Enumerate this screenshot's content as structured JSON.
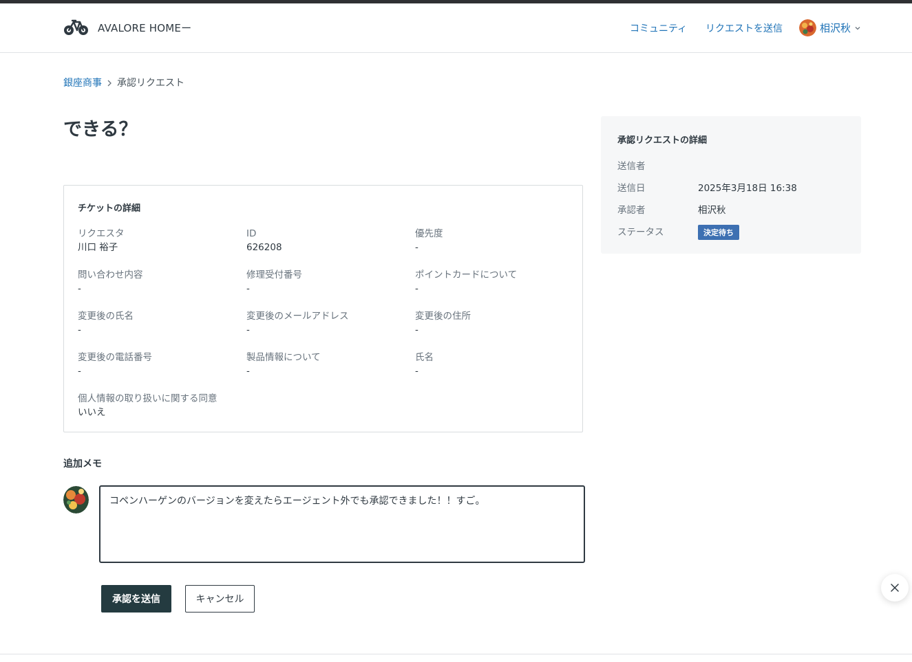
{
  "header": {
    "brand": "AVALORE HOMEー",
    "nav": {
      "community": "コミュニティ",
      "submit_request": "リクエストを送信"
    },
    "user": {
      "name": "相沢秋"
    }
  },
  "breadcrumb": {
    "parent": "銀座商事",
    "current": "承認リクエスト"
  },
  "page_title": "できる？",
  "ticket": {
    "heading": "チケットの詳細",
    "fields": [
      {
        "label": "リクエスタ",
        "value": "川口 裕子"
      },
      {
        "label": "ID",
        "value": "626208"
      },
      {
        "label": "優先度",
        "value": "-"
      },
      {
        "label": "問い合わせ内容",
        "value": "-"
      },
      {
        "label": "修理受付番号",
        "value": "-"
      },
      {
        "label": "ポイントカードについて",
        "value": "-"
      },
      {
        "label": "変更後の氏名",
        "value": "-"
      },
      {
        "label": "変更後のメールアドレス",
        "value": "-"
      },
      {
        "label": "変更後の住所",
        "value": "-"
      },
      {
        "label": "変更後の電話番号",
        "value": "-"
      },
      {
        "label": "製品情報について",
        "value": "-"
      },
      {
        "label": "氏名",
        "value": "-"
      },
      {
        "label": "個人情報の取り扱いに関する同意",
        "value": "いいえ"
      }
    ]
  },
  "approval": {
    "heading": "承認リクエストの詳細",
    "sender_label": "送信者",
    "sender_value": "",
    "sent_date_label": "送信日",
    "sent_date_value": "2025年3月18日 16:38",
    "approver_label": "承認者",
    "approver_value": "相沢秋",
    "status_label": "ステータス",
    "status_value": "決定待ち",
    "status_color": "#3d70b2"
  },
  "memo": {
    "heading": "追加メモ",
    "value": "コペンハーゲンのバージョンを変えたらエージェント外でも承認できました！！すご。"
  },
  "actions": {
    "submit": "承認を送信",
    "cancel": "キャンセル"
  },
  "colors": {
    "link": "#1f73b7",
    "primary_button": "#243b40",
    "text": "#2f3941"
  }
}
